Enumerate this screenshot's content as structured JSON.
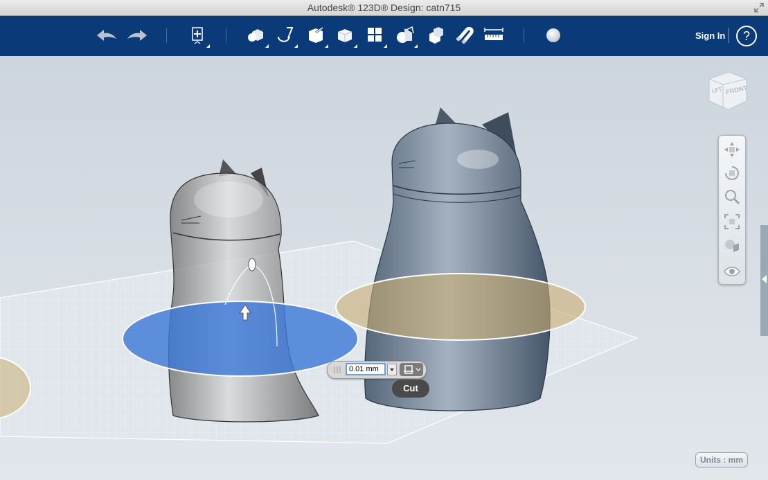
{
  "window": {
    "title": "Autodesk® 123D® Design: catn715"
  },
  "toolbar": {
    "tools": [
      "undo-icon",
      "redo-icon",
      "transform-icon",
      "primitives-icon",
      "sketch-icon",
      "construct-icon",
      "modify-icon",
      "pattern-icon",
      "grouping-icon",
      "combine-icon",
      "snap-icon",
      "measure-icon",
      "material-icon"
    ],
    "sign_in": "Sign In",
    "help": "?"
  },
  "viewcube": {
    "left_face": "LFT",
    "front_face": "FRONT"
  },
  "navbar": {
    "tools": [
      "pan-icon",
      "orbit-icon",
      "zoom-icon",
      "fit-icon",
      "view-mode-icon",
      "visibility-icon"
    ]
  },
  "cut_tool": {
    "value": "0.01 mm",
    "tooltip": "Cut"
  },
  "status": {
    "units": "Units : mm"
  },
  "colors": {
    "toolbar": "#0b3a78",
    "cut_plane": "#3c78d8",
    "model": "#6e7f91"
  }
}
